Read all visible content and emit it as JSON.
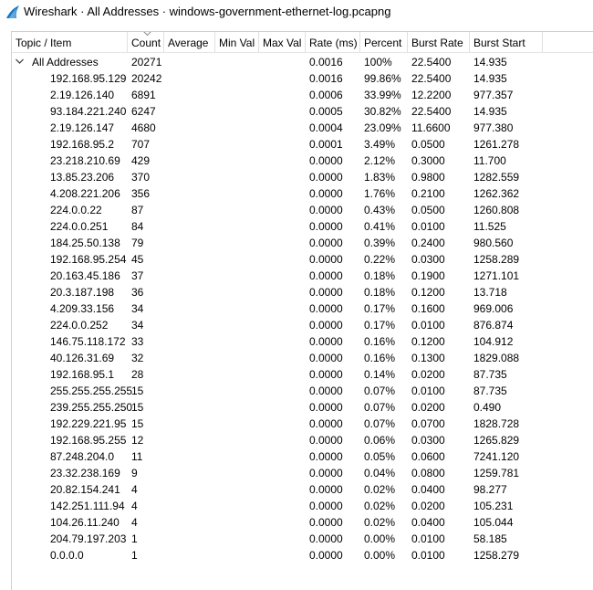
{
  "window": {
    "title": "Wireshark · All Addresses · windows-government-ethernet-log.pcapng",
    "icon": "wireshark-fin-icon",
    "accent": "#1679c6"
  },
  "columns": [
    "Topic / Item",
    "Count",
    "Average",
    "Min Val",
    "Max Val",
    "Rate (ms)",
    "Percent",
    "Burst Rate",
    "Burst Start"
  ],
  "sort": {
    "column": "Count",
    "direction": "descending",
    "icon": "sort-descending-icon"
  },
  "root": {
    "label": "All Addresses",
    "count": "20271",
    "rate": "0.0016",
    "percent": "100%",
    "burst_rate": "22.5400",
    "burst_start": "14.935",
    "expanded": true,
    "icon": "chevron-down-icon"
  },
  "rows": [
    {
      "item": "192.168.95.129",
      "count": "20242",
      "rate": "0.0016",
      "percent": "99.86%",
      "burst_rate": "22.5400",
      "burst_start": "14.935"
    },
    {
      "item": "2.19.126.140",
      "count": "6891",
      "rate": "0.0006",
      "percent": "33.99%",
      "burst_rate": "12.2200",
      "burst_start": "977.357"
    },
    {
      "item": "93.184.221.240",
      "count": "6247",
      "rate": "0.0005",
      "percent": "30.82%",
      "burst_rate": "22.5400",
      "burst_start": "14.935"
    },
    {
      "item": "2.19.126.147",
      "count": "4680",
      "rate": "0.0004",
      "percent": "23.09%",
      "burst_rate": "11.6600",
      "burst_start": "977.380"
    },
    {
      "item": "192.168.95.2",
      "count": "707",
      "rate": "0.0001",
      "percent": "3.49%",
      "burst_rate": "0.0500",
      "burst_start": "1261.278"
    },
    {
      "item": "23.218.210.69",
      "count": "429",
      "rate": "0.0000",
      "percent": "2.12%",
      "burst_rate": "0.3000",
      "burst_start": "11.700"
    },
    {
      "item": "13.85.23.206",
      "count": "370",
      "rate": "0.0000",
      "percent": "1.83%",
      "burst_rate": "0.9800",
      "burst_start": "1282.559"
    },
    {
      "item": "4.208.221.206",
      "count": "356",
      "rate": "0.0000",
      "percent": "1.76%",
      "burst_rate": "0.2100",
      "burst_start": "1262.362"
    },
    {
      "item": "224.0.0.22",
      "count": "87",
      "rate": "0.0000",
      "percent": "0.43%",
      "burst_rate": "0.0500",
      "burst_start": "1260.808"
    },
    {
      "item": "224.0.0.251",
      "count": "84",
      "rate": "0.0000",
      "percent": "0.41%",
      "burst_rate": "0.0100",
      "burst_start": "11.525"
    },
    {
      "item": "184.25.50.138",
      "count": "79",
      "rate": "0.0000",
      "percent": "0.39%",
      "burst_rate": "0.2400",
      "burst_start": "980.560"
    },
    {
      "item": "192.168.95.254",
      "count": "45",
      "rate": "0.0000",
      "percent": "0.22%",
      "burst_rate": "0.0300",
      "burst_start": "1258.289"
    },
    {
      "item": "20.163.45.186",
      "count": "37",
      "rate": "0.0000",
      "percent": "0.18%",
      "burst_rate": "0.1900",
      "burst_start": "1271.101"
    },
    {
      "item": "20.3.187.198",
      "count": "36",
      "rate": "0.0000",
      "percent": "0.18%",
      "burst_rate": "0.1200",
      "burst_start": "13.718"
    },
    {
      "item": "4.209.33.156",
      "count": "34",
      "rate": "0.0000",
      "percent": "0.17%",
      "burst_rate": "0.1600",
      "burst_start": "969.006"
    },
    {
      "item": "224.0.0.252",
      "count": "34",
      "rate": "0.0000",
      "percent": "0.17%",
      "burst_rate": "0.0100",
      "burst_start": "876.874"
    },
    {
      "item": "146.75.118.172",
      "count": "33",
      "rate": "0.0000",
      "percent": "0.16%",
      "burst_rate": "0.1200",
      "burst_start": "104.912"
    },
    {
      "item": "40.126.31.69",
      "count": "32",
      "rate": "0.0000",
      "percent": "0.16%",
      "burst_rate": "0.1300",
      "burst_start": "1829.088"
    },
    {
      "item": "192.168.95.1",
      "count": "28",
      "rate": "0.0000",
      "percent": "0.14%",
      "burst_rate": "0.0200",
      "burst_start": "87.735"
    },
    {
      "item": "255.255.255.255",
      "count": "15",
      "rate": "0.0000",
      "percent": "0.07%",
      "burst_rate": "0.0100",
      "burst_start": "87.735"
    },
    {
      "item": "239.255.255.250",
      "count": "15",
      "rate": "0.0000",
      "percent": "0.07%",
      "burst_rate": "0.0200",
      "burst_start": "0.490"
    },
    {
      "item": "192.229.221.95",
      "count": "15",
      "rate": "0.0000",
      "percent": "0.07%",
      "burst_rate": "0.0700",
      "burst_start": "1828.728"
    },
    {
      "item": "192.168.95.255",
      "count": "12",
      "rate": "0.0000",
      "percent": "0.06%",
      "burst_rate": "0.0300",
      "burst_start": "1265.829"
    },
    {
      "item": "87.248.204.0",
      "count": "11",
      "rate": "0.0000",
      "percent": "0.05%",
      "burst_rate": "0.0600",
      "burst_start": "7241.120"
    },
    {
      "item": "23.32.238.169",
      "count": "9",
      "rate": "0.0000",
      "percent": "0.04%",
      "burst_rate": "0.0800",
      "burst_start": "1259.781"
    },
    {
      "item": "20.82.154.241",
      "count": "4",
      "rate": "0.0000",
      "percent": "0.02%",
      "burst_rate": "0.0400",
      "burst_start": "98.277"
    },
    {
      "item": "142.251.111.94",
      "count": "4",
      "rate": "0.0000",
      "percent": "0.02%",
      "burst_rate": "0.0200",
      "burst_start": "105.231"
    },
    {
      "item": "104.26.11.240",
      "count": "4",
      "rate": "0.0000",
      "percent": "0.02%",
      "burst_rate": "0.0400",
      "burst_start": "105.044"
    },
    {
      "item": "204.79.197.203",
      "count": "1",
      "rate": "0.0000",
      "percent": "0.00%",
      "burst_rate": "0.0100",
      "burst_start": "58.185"
    },
    {
      "item": "0.0.0.0",
      "count": "1",
      "rate": "0.0000",
      "percent": "0.00%",
      "burst_rate": "0.0100",
      "burst_start": "1258.279"
    }
  ]
}
